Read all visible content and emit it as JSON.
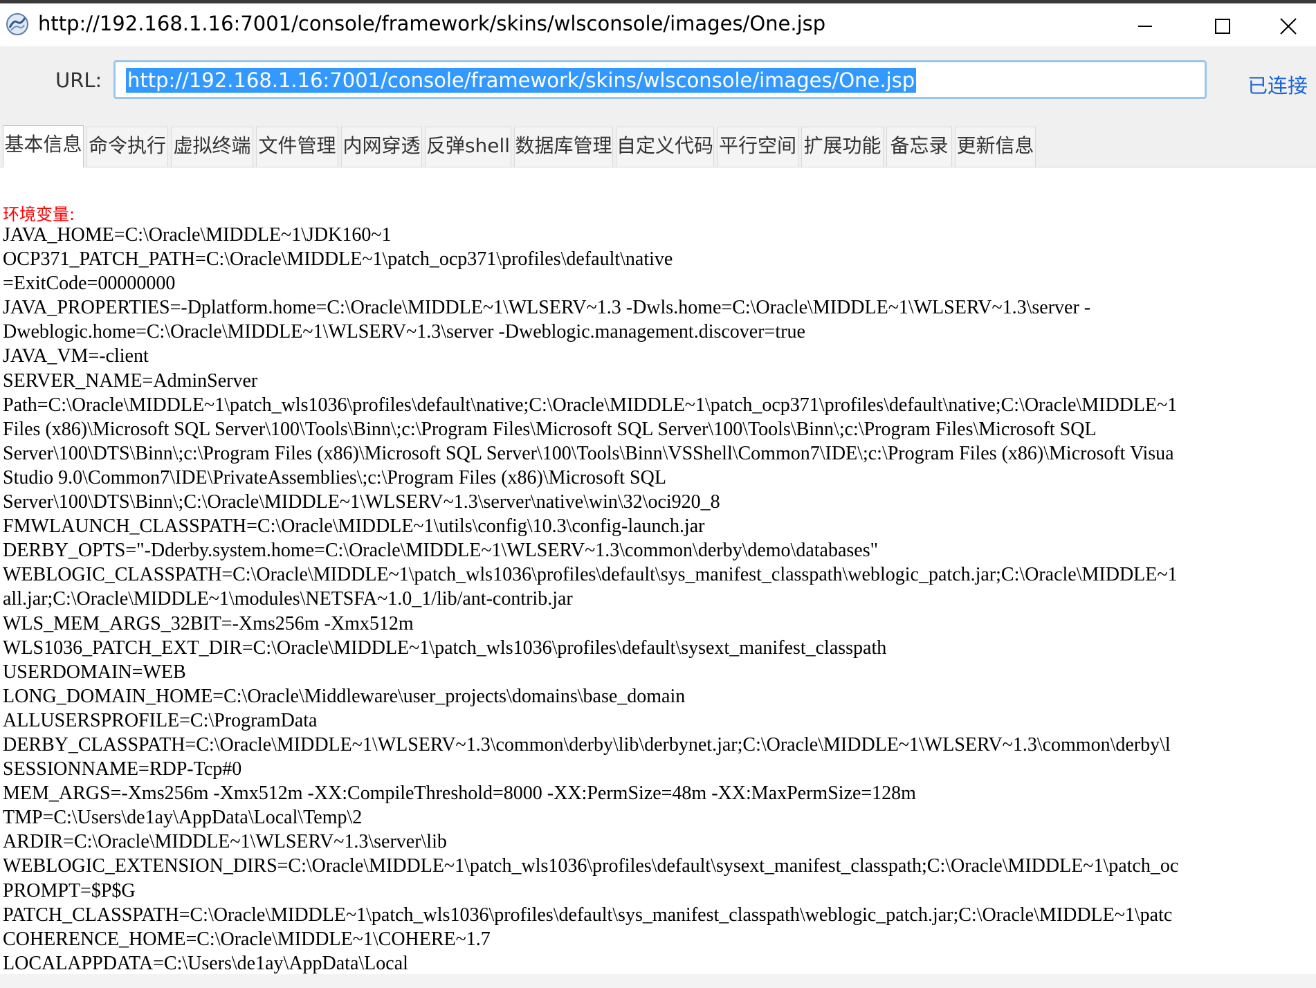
{
  "window": {
    "title": "http://192.168.1.16:7001/console/framework/skins/wlsconsole/images/One.jsp",
    "app_icon": "webshell-manager-icon"
  },
  "urlbar": {
    "label": "URL:",
    "value": "http://192.168.1.16:7001/console/framework/skins/wlsconsole/images/One.jsp",
    "status": "已连接"
  },
  "tabs": [
    {
      "label": "基本信息",
      "active": true
    },
    {
      "label": "命令执行",
      "active": false
    },
    {
      "label": "虚拟终端",
      "active": false
    },
    {
      "label": "文件管理",
      "active": false
    },
    {
      "label": "内网穿透",
      "active": false
    },
    {
      "label": "反弹shell",
      "active": false
    },
    {
      "label": "数据库管理",
      "active": false
    },
    {
      "label": "自定义代码",
      "active": false
    },
    {
      "label": "平行空间",
      "active": false
    },
    {
      "label": "扩展功能",
      "active": false
    },
    {
      "label": "备忘录",
      "active": false
    },
    {
      "label": "更新信息",
      "active": false
    }
  ],
  "content": {
    "heading": "环境变量:",
    "lines": [
      "JAVA_HOME=C:\\Oracle\\MIDDLE~1\\JDK160~1",
      "OCP371_PATCH_PATH=C:\\Oracle\\MIDDLE~1\\patch_ocp371\\profiles\\default\\native",
      "=ExitCode=00000000",
      "JAVA_PROPERTIES=-Dplatform.home=C:\\Oracle\\MIDDLE~1\\WLSERV~1.3 -Dwls.home=C:\\Oracle\\MIDDLE~1\\WLSERV~1.3\\server -",
      "Dweblogic.home=C:\\Oracle\\MIDDLE~1\\WLSERV~1.3\\server -Dweblogic.management.discover=true",
      "JAVA_VM=-client",
      "SERVER_NAME=AdminServer",
      "Path=C:\\Oracle\\MIDDLE~1\\patch_wls1036\\profiles\\default\\native;C:\\Oracle\\MIDDLE~1\\patch_ocp371\\profiles\\default\\native;C:\\Oracle\\MIDDLE~1",
      "Files (x86)\\Microsoft SQL Server\\100\\Tools\\Binn\\;c:\\Program Files\\Microsoft SQL Server\\100\\Tools\\Binn\\;c:\\Program Files\\Microsoft SQL",
      "Server\\100\\DTS\\Binn\\;c:\\Program Files (x86)\\Microsoft SQL Server\\100\\Tools\\Binn\\VSShell\\Common7\\IDE\\;c:\\Program Files (x86)\\Microsoft Visua",
      "Studio 9.0\\Common7\\IDE\\PrivateAssemblies\\;c:\\Program Files (x86)\\Microsoft SQL",
      "Server\\100\\DTS\\Binn\\;C:\\Oracle\\MIDDLE~1\\WLSERV~1.3\\server\\native\\win\\32\\oci920_8",
      "FMWLAUNCH_CLASSPATH=C:\\Oracle\\MIDDLE~1\\utils\\config\\10.3\\config-launch.jar",
      "DERBY_OPTS=\"-Dderby.system.home=C:\\Oracle\\MIDDLE~1\\WLSERV~1.3\\common\\derby\\demo\\databases\"",
      "WEBLOGIC_CLASSPATH=C:\\Oracle\\MIDDLE~1\\patch_wls1036\\profiles\\default\\sys_manifest_classpath\\weblogic_patch.jar;C:\\Oracle\\MIDDLE~1",
      "all.jar;C:\\Oracle\\MIDDLE~1\\modules\\NETSFA~1.0_1/lib/ant-contrib.jar",
      "WLS_MEM_ARGS_32BIT=-Xms256m -Xmx512m",
      "WLS1036_PATCH_EXT_DIR=C:\\Oracle\\MIDDLE~1\\patch_wls1036\\profiles\\default\\sysext_manifest_classpath",
      "USERDOMAIN=WEB",
      "LONG_DOMAIN_HOME=C:\\Oracle\\Middleware\\user_projects\\domains\\base_domain",
      "ALLUSERSPROFILE=C:\\ProgramData",
      "DERBY_CLASSPATH=C:\\Oracle\\MIDDLE~1\\WLSERV~1.3\\common\\derby\\lib\\derbynet.jar;C:\\Oracle\\MIDDLE~1\\WLSERV~1.3\\common\\derby\\l",
      "SESSIONNAME=RDP-Tcp#0",
      "MEM_ARGS=-Xms256m -Xmx512m -XX:CompileThreshold=8000 -XX:PermSize=48m -XX:MaxPermSize=128m",
      "TMP=C:\\Users\\de1ay\\AppData\\Local\\Temp\\2",
      "ARDIR=C:\\Oracle\\MIDDLE~1\\WLSERV~1.3\\server\\lib",
      "WEBLOGIC_EXTENSION_DIRS=C:\\Oracle\\MIDDLE~1\\patch_wls1036\\profiles\\default\\sysext_manifest_classpath;C:\\Oracle\\MIDDLE~1\\patch_oc",
      "PROMPT=$P$G",
      "PATCH_CLASSPATH=C:\\Oracle\\MIDDLE~1\\patch_wls1036\\profiles\\default\\sys_manifest_classpath\\weblogic_patch.jar;C:\\Oracle\\MIDDLE~1\\patc",
      "COHERENCE_HOME=C:\\Oracle\\MIDDLE~1\\COHERE~1.7",
      "LOCALAPPDATA=C:\\Users\\de1ay\\AppData\\Local"
    ]
  },
  "colors": {
    "heading": "#ff0000",
    "status_link": "#1a64d6",
    "url_selection": "#3399ff",
    "url_border": "#9cc5ea",
    "chrome_bg": "#f0f0f0"
  }
}
